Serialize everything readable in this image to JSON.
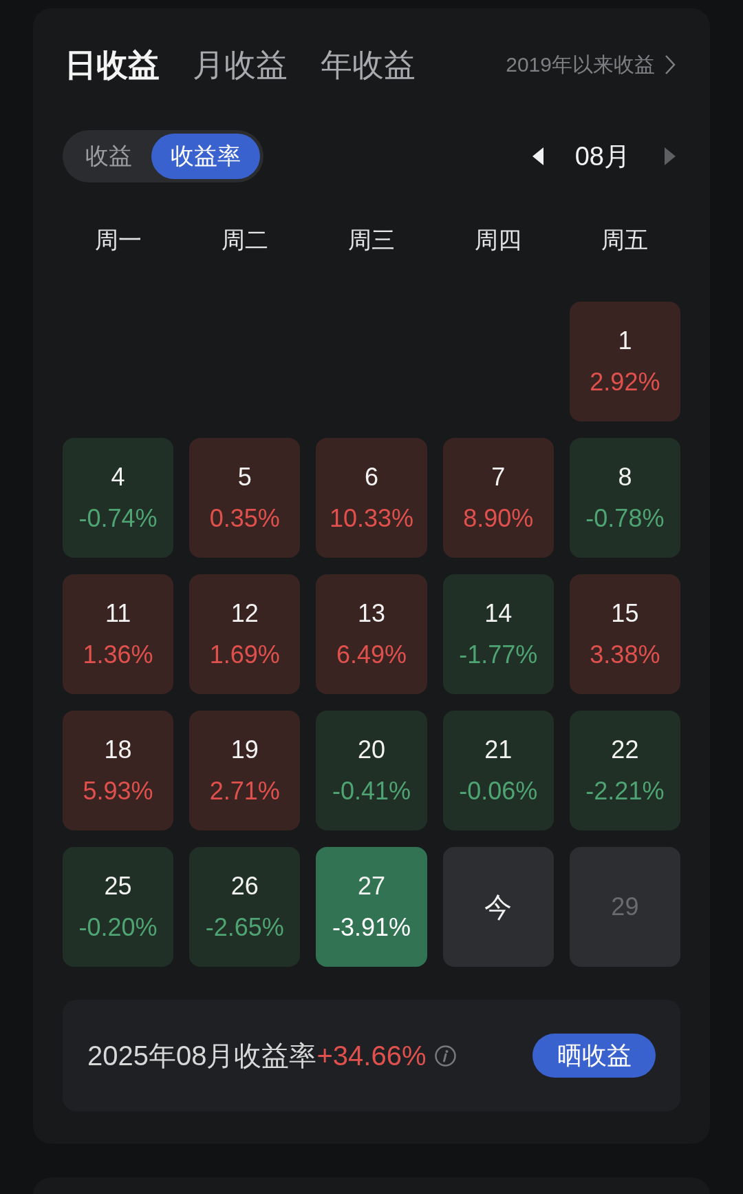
{
  "tabs": [
    {
      "label": "日收益",
      "selected": true
    },
    {
      "label": "月收益",
      "selected": false
    },
    {
      "label": "年收益",
      "selected": false
    }
  ],
  "history_link": {
    "label": "2019年以来收益"
  },
  "mode_toggle": [
    {
      "label": "收益",
      "selected": false
    },
    {
      "label": "收益率",
      "selected": true
    }
  ],
  "month_nav": {
    "label": "08月",
    "prev_disabled": false,
    "next_disabled": true
  },
  "weekdays": [
    "周一",
    "周二",
    "周三",
    "周四",
    "周五"
  ],
  "weeks": [
    [
      {
        "kind": "blank"
      },
      {
        "kind": "blank"
      },
      {
        "kind": "blank"
      },
      {
        "kind": "blank"
      },
      {
        "kind": "gain",
        "day": "1",
        "value": "2.92%",
        "selected": false
      }
    ],
    [
      {
        "kind": "loss",
        "day": "4",
        "value": "-0.74%",
        "selected": false
      },
      {
        "kind": "gain",
        "day": "5",
        "value": "0.35%",
        "selected": false
      },
      {
        "kind": "gain",
        "day": "6",
        "value": "10.33%",
        "selected": false
      },
      {
        "kind": "gain",
        "day": "7",
        "value": "8.90%",
        "selected": false
      },
      {
        "kind": "loss",
        "day": "8",
        "value": "-0.78%",
        "selected": false
      }
    ],
    [
      {
        "kind": "gain",
        "day": "11",
        "value": "1.36%",
        "selected": false
      },
      {
        "kind": "gain",
        "day": "12",
        "value": "1.69%",
        "selected": false
      },
      {
        "kind": "gain",
        "day": "13",
        "value": "6.49%",
        "selected": false
      },
      {
        "kind": "loss",
        "day": "14",
        "value": "-1.77%",
        "selected": false
      },
      {
        "kind": "gain",
        "day": "15",
        "value": "3.38%",
        "selected": false
      }
    ],
    [
      {
        "kind": "gain",
        "day": "18",
        "value": "5.93%",
        "selected": false
      },
      {
        "kind": "gain",
        "day": "19",
        "value": "2.71%",
        "selected": false
      },
      {
        "kind": "loss",
        "day": "20",
        "value": "-0.41%",
        "selected": false
      },
      {
        "kind": "loss",
        "day": "21",
        "value": "-0.06%",
        "selected": false
      },
      {
        "kind": "loss",
        "day": "22",
        "value": "-2.21%",
        "selected": false
      }
    ],
    [
      {
        "kind": "loss",
        "day": "25",
        "value": "-0.20%",
        "selected": false
      },
      {
        "kind": "loss",
        "day": "26",
        "value": "-2.65%",
        "selected": false
      },
      {
        "kind": "loss",
        "day": "27",
        "value": "-3.91%",
        "selected": true
      },
      {
        "kind": "today",
        "label": "今",
        "selected": false
      },
      {
        "kind": "future",
        "day": "29",
        "selected": false
      }
    ]
  ],
  "summary": {
    "label": "2025年08月收益率",
    "value": "+34.66%",
    "kind": "gain",
    "button": "晒收益"
  }
}
